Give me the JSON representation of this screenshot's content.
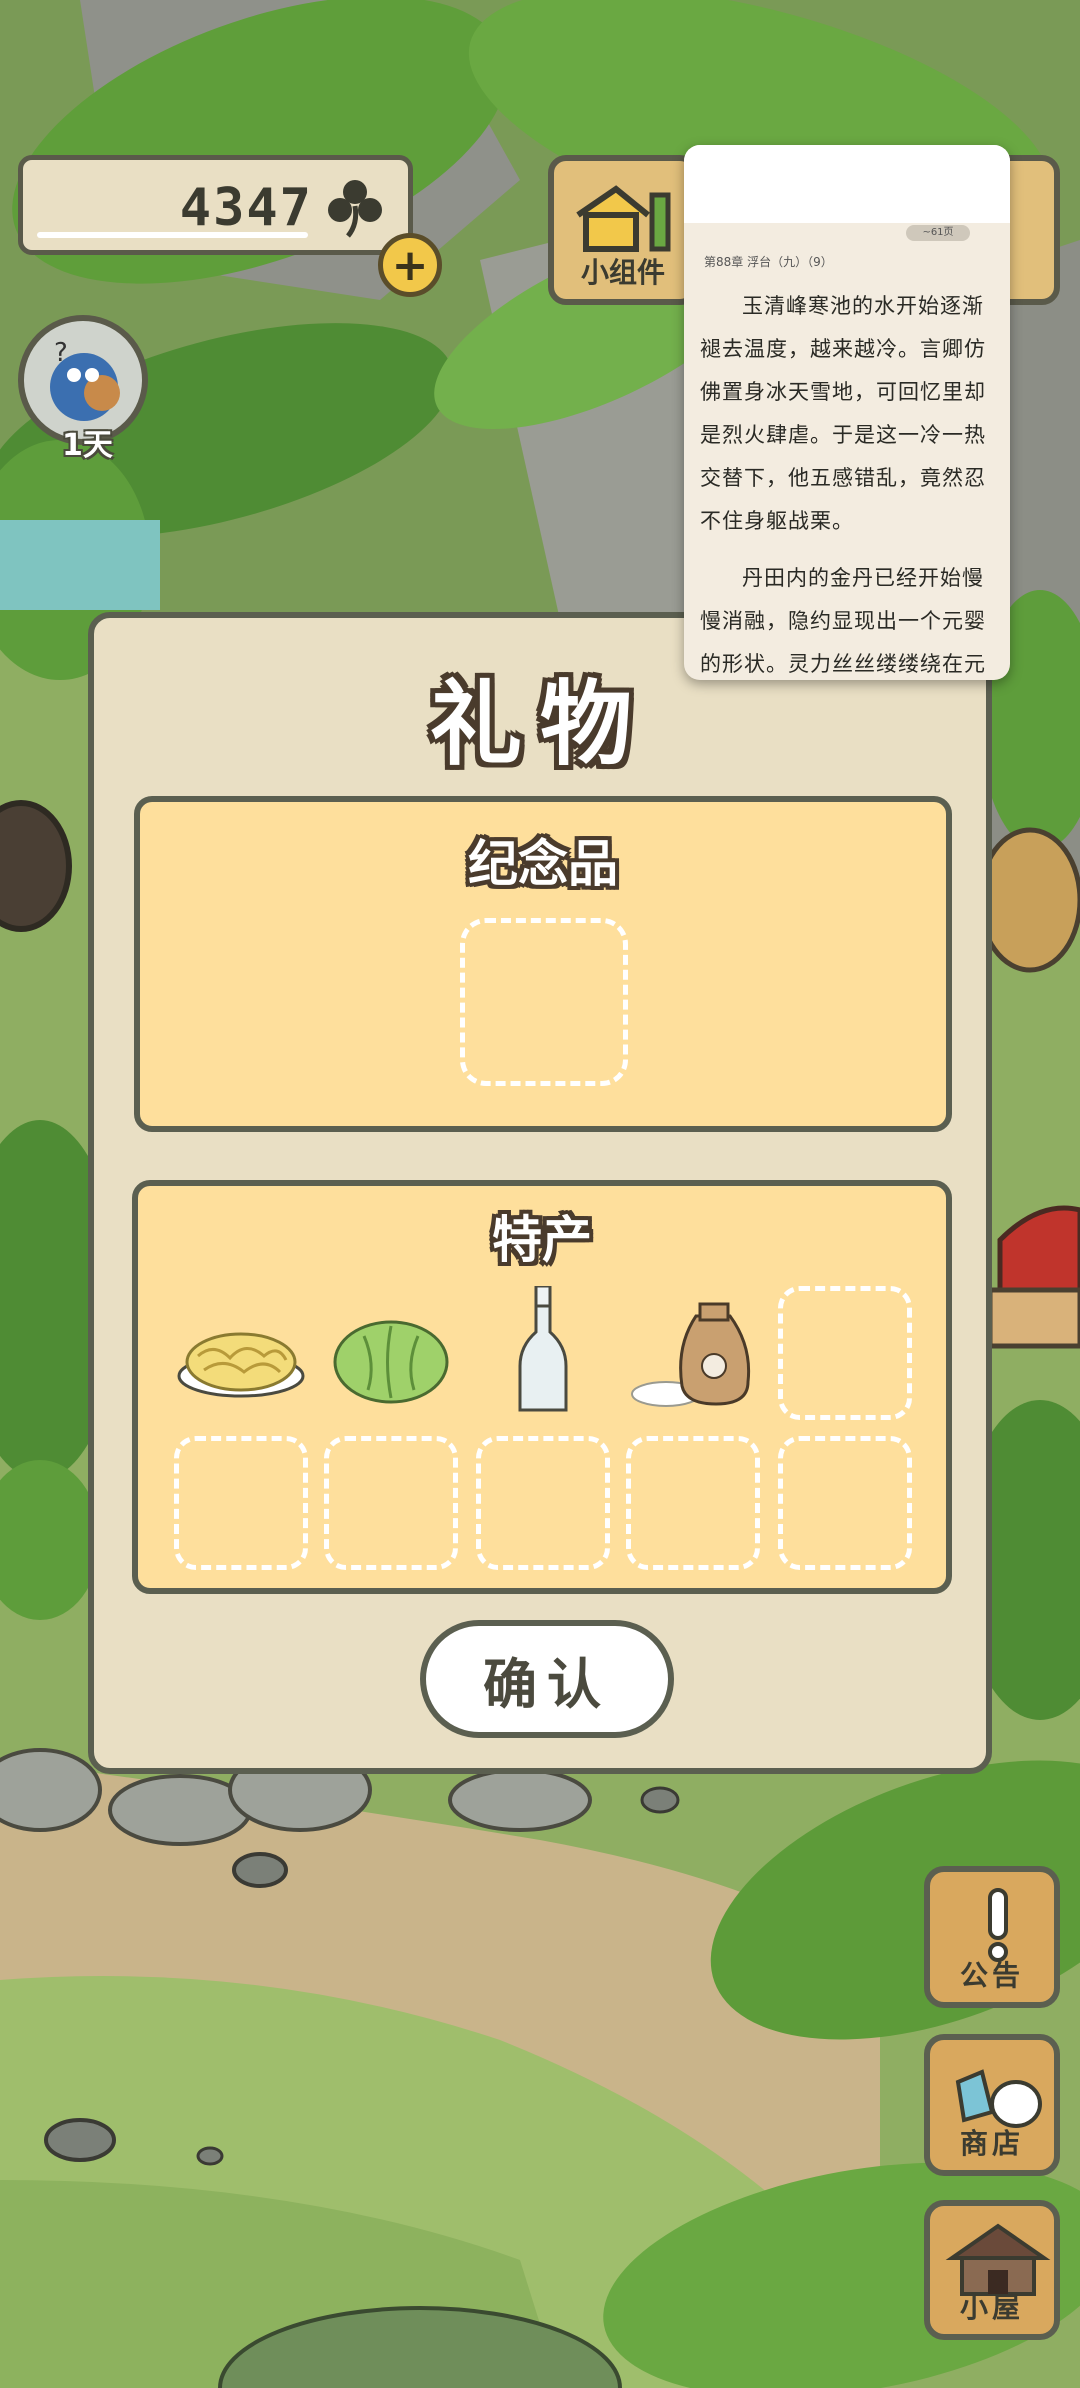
{
  "hud": {
    "clover_count": "4347",
    "day_label": "1天",
    "widget_label": "小组件"
  },
  "reader": {
    "chapter": "第88章 浮台（九）（9）",
    "badge": "~61页",
    "paragraphs": [
      "玉清峰寒池的水开始逐渐褪去温度，越来越冷。言卿仿佛置身冰天雪地，可回忆里却是烈火肆虐。于是这一冷一热交替下，他五感错乱，竟然忍不住身躯战栗。",
      "丹田内的金丹已经开始慢慢消融，隐约显现出一个元婴的形状。灵力丝丝缕缕绕在元婴身边，谢识衣说重新结婴"
    ]
  },
  "dialog": {
    "title": "礼物",
    "souvenir_title": "纪念品",
    "specialty_title": "特产",
    "items": [
      "fried-noodles",
      "cabbage",
      "glass-bottle",
      "rice-sack"
    ],
    "confirm_label": "确认"
  },
  "side_menu": {
    "notice_label": "公告",
    "shop_label": "商店",
    "house_label": "小屋"
  },
  "colors": {
    "panel": "#fedf9c",
    "dialog": "#e9dfc4",
    "outline": "#5b5f50",
    "side_button": "#d9a85e"
  }
}
